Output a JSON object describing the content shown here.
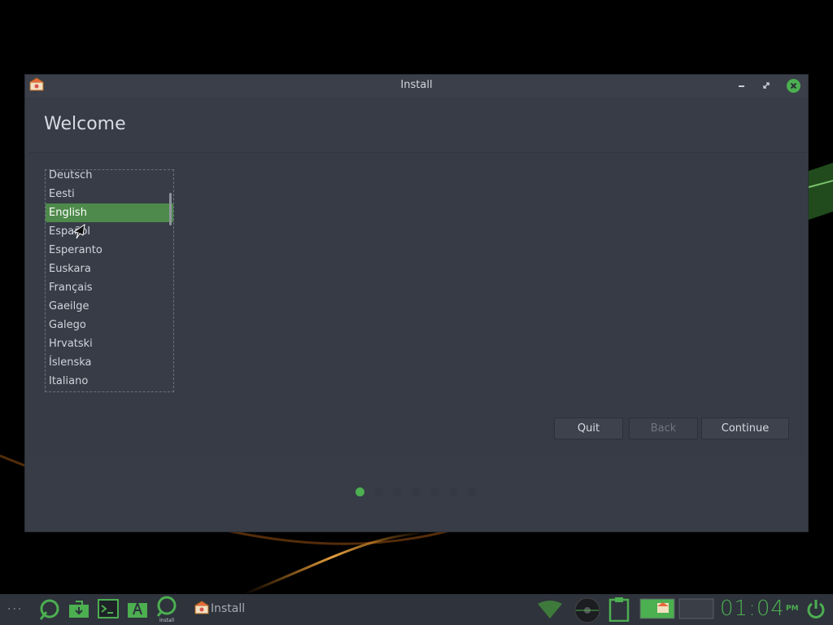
{
  "window": {
    "title": "Install",
    "heading": "Welcome"
  },
  "languages": {
    "items": [
      "Deutsch",
      "Eesti",
      "English",
      "Español",
      "Esperanto",
      "Euskara",
      "Français",
      "Gaeilge",
      "Galego",
      "Hrvatski",
      "Íslenska",
      "Italiano"
    ],
    "selected": "English"
  },
  "buttons": {
    "quit": "Quit",
    "back": "Back",
    "continue": "Continue"
  },
  "progress": {
    "steps_total": 7,
    "current_step": 1
  },
  "taskbar": {
    "install_icon_label": "Install",
    "window_label": "Install",
    "clock_digits": "01:04",
    "clock_suffix": "PM"
  },
  "colors": {
    "accent": "#4caf50",
    "window_bg": "#373c47",
    "selection": "#4e8a4b"
  }
}
